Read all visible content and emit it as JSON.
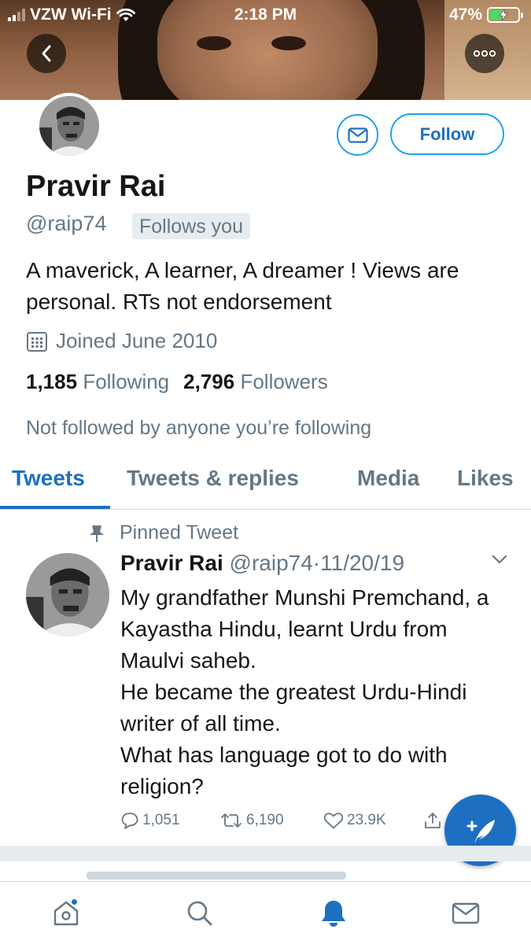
{
  "status_bar": {
    "carrier": "VZW Wi-Fi",
    "time": "2:18 PM",
    "battery_percent": "47%",
    "battery_level": 0.47
  },
  "header": {
    "back_icon": "chevron-left-icon",
    "more_icon": "more-horizontal-icon"
  },
  "profile": {
    "display_name": "Pravir Rai",
    "handle": "@raip74",
    "follows_you": "Follows you",
    "bio": "A maverick, A learner, A dreamer ! Views are personal. RTs not endorsement",
    "joined": "Joined June 2010",
    "following_count": "1,185",
    "following_label": "Following",
    "followers_count": "2,796",
    "followers_label": "Followers",
    "not_followed": "Not followed by anyone you’re following",
    "follow_label": "Follow",
    "message_icon": "mail-icon"
  },
  "tabs": [
    {
      "label": "Tweets",
      "active": true
    },
    {
      "label": "Tweets & replies",
      "active": false
    },
    {
      "label": "Media",
      "active": false
    },
    {
      "label": "Likes",
      "active": false
    }
  ],
  "pinned_tweet": {
    "pinned_label": "Pinned Tweet",
    "author_name": "Pravir Rai",
    "author_handle": "@raip74",
    "separator": "·",
    "date": "11/20/19",
    "text": "My grandfather Munshi Premchand, a Kayastha Hindu, learnt Urdu from Maulvi saheb.\nHe became the greatest Urdu-Hindi writer of all time.\nWhat has language got to do with religion?",
    "replies": "1,051",
    "retweets": "6,190",
    "likes": "23.9K"
  },
  "colors": {
    "accent": "#1d6fc2",
    "secondary_text": "#657786",
    "primary_text": "#14171a"
  },
  "bottom_nav": [
    "home-icon",
    "search-icon",
    "notifications-icon",
    "messages-icon"
  ]
}
